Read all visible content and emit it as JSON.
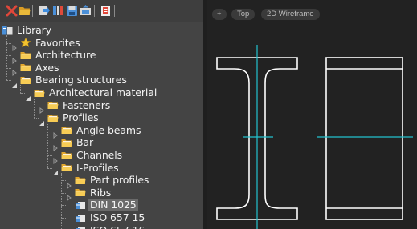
{
  "toolbar": {
    "buttons": [
      {
        "name": "delete-icon",
        "color": "#e0473a"
      },
      {
        "name": "open-folder-icon",
        "color": "#e9b93a"
      },
      {
        "name": "insert-icon",
        "color": "#dadada"
      },
      {
        "name": "library-icon",
        "color": "#dadada"
      },
      {
        "name": "save-icon",
        "color": "#dadada"
      },
      {
        "name": "export-icon",
        "color": "#dadada"
      },
      {
        "name": "document-icon",
        "color": "#e0473a"
      }
    ]
  },
  "tree": {
    "root": {
      "label": "Library",
      "icon": "library-icon"
    },
    "items": [
      {
        "label": "Favorites",
        "icon": "star-icon",
        "level": 1,
        "expander": "collapsed"
      },
      {
        "label": "Architecture",
        "icon": "folder-icon",
        "level": 1,
        "expander": "collapsed"
      },
      {
        "label": "Axes",
        "icon": "folder-icon",
        "level": 1,
        "expander": "collapsed"
      },
      {
        "label": "Bearing structures",
        "icon": "folder-icon",
        "level": 1,
        "expander": "expanded"
      },
      {
        "label": "Architectural material",
        "icon": "folder-icon",
        "level": 2,
        "expander": "expanded"
      },
      {
        "label": "Fasteners",
        "icon": "folder-icon",
        "level": 3,
        "expander": "collapsed"
      },
      {
        "label": "Profiles",
        "icon": "folder-icon",
        "level": 3,
        "expander": "expanded"
      },
      {
        "label": "Angle beams",
        "icon": "folder-icon",
        "level": 4,
        "expander": "collapsed"
      },
      {
        "label": "Bar",
        "icon": "folder-icon",
        "level": 4,
        "expander": "collapsed"
      },
      {
        "label": "Channels",
        "icon": "folder-icon",
        "level": 4,
        "expander": "collapsed"
      },
      {
        "label": "I-Profiles",
        "icon": "folder-icon",
        "level": 4,
        "expander": "expanded"
      },
      {
        "label": "Part profiles",
        "icon": "folder-icon",
        "level": 5,
        "expander": "collapsed"
      },
      {
        "label": "Ribs",
        "icon": "folder-icon",
        "level": 5,
        "expander": "collapsed"
      },
      {
        "label": "DIN 1025",
        "icon": "part-icon",
        "level": 5,
        "expander": "none",
        "selected": true
      },
      {
        "label": "ISO 657 15",
        "icon": "part-icon",
        "level": 5,
        "expander": "none"
      },
      {
        "label": "ISO 657 16",
        "icon": "part-icon",
        "level": 5,
        "expander": "none"
      }
    ]
  },
  "viewport": {
    "controls": [
      "+",
      "Top",
      "2D Wireframe"
    ],
    "line_color": "#ffffff",
    "axis_color": "#22c3cf"
  }
}
